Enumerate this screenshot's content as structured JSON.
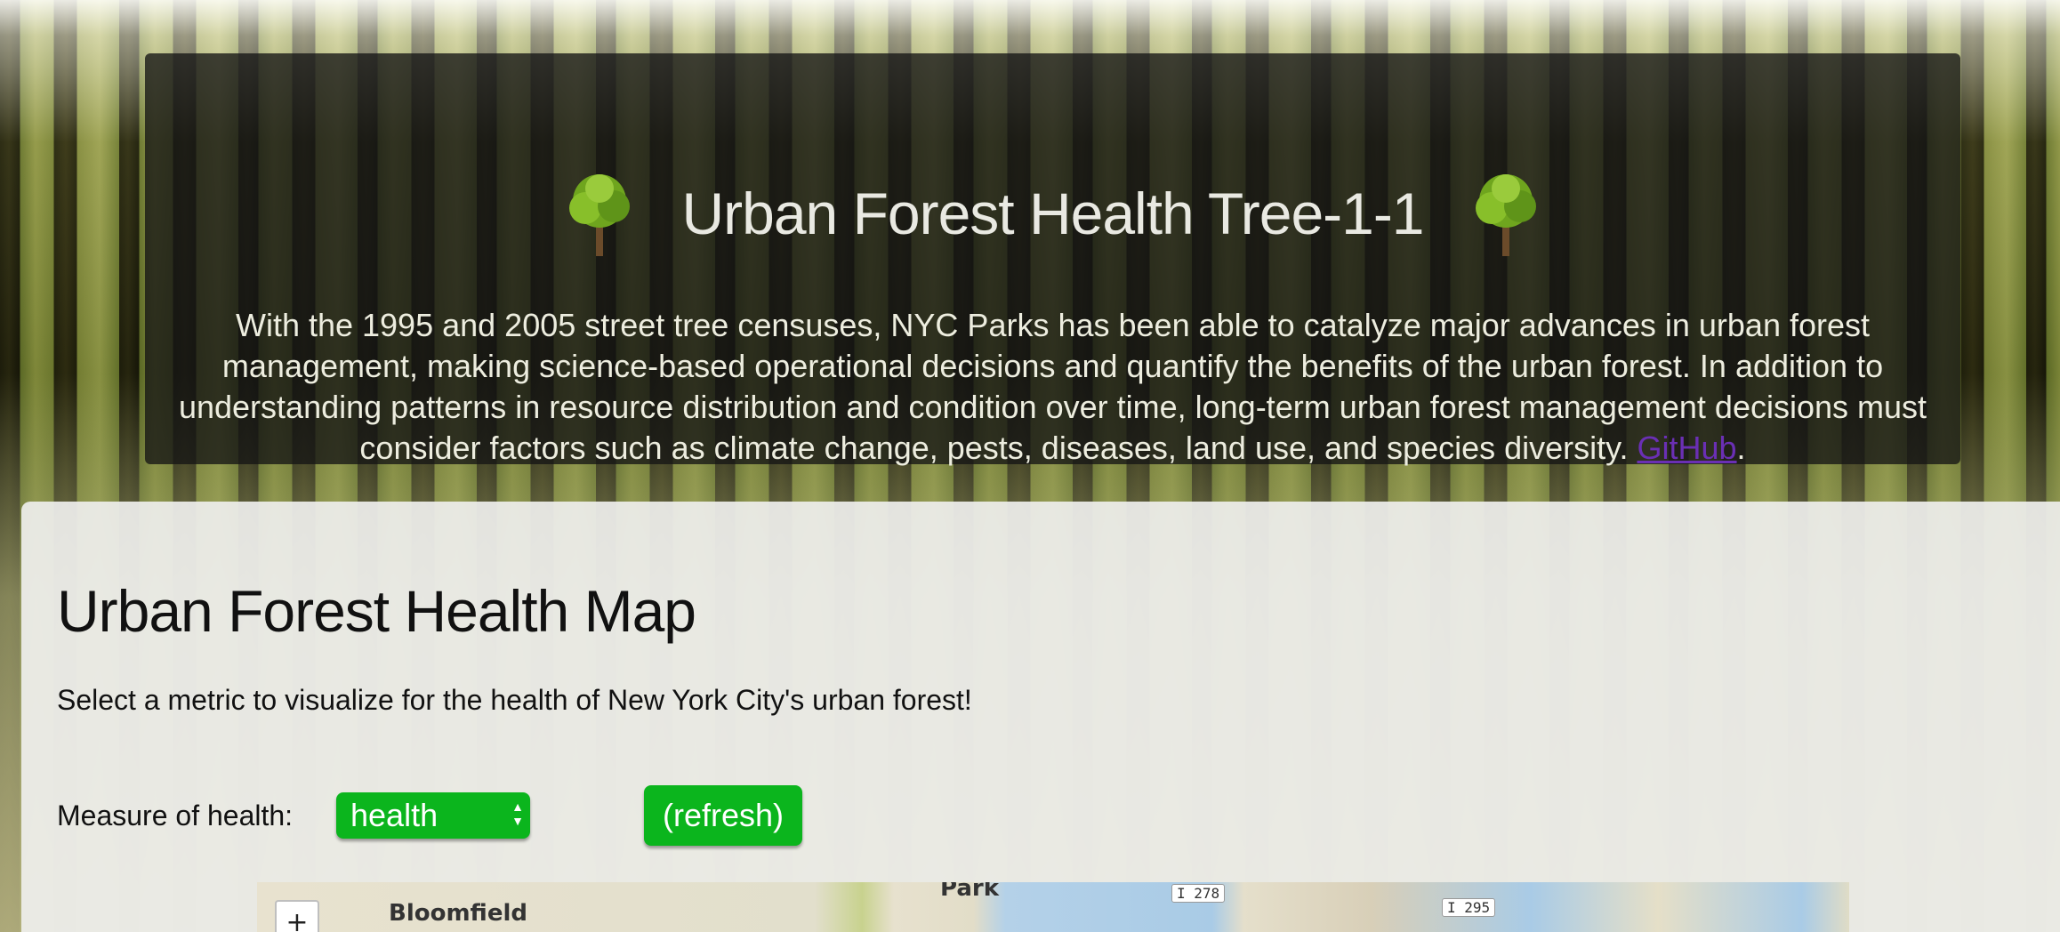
{
  "header": {
    "title": "Urban Forest Health Tree-1-1",
    "intro": "With the 1995 and 2005 street tree censuses, NYC Parks has been able to catalyze major advances in urban forest management, making science-based operational decisions and quantify the benefits of the urban forest. In addition to understanding patterns in resource distribution and condition over time, long-term urban forest management decisions must consider factors such as climate change, pests, diseases, land use, and species diversity.",
    "link_label": "GitHub",
    "link_suffix": ".",
    "icons": [
      "tree-icon",
      "tree-icon"
    ]
  },
  "main": {
    "title": "Urban Forest Health Map",
    "subtitle": "Select a metric to visualize for the health of New York City's urban forest!",
    "measure_label": "Measure of health:",
    "select_value": "health",
    "refresh_label": "(refresh)"
  },
  "map": {
    "zoom_in": "+",
    "labels": [
      "Bloomfield",
      "Park"
    ],
    "shields": [
      "I 278",
      "I 295"
    ]
  },
  "colors": {
    "accent_green": "#0bb51d",
    "link_purple": "#6a2fb4",
    "header_bg": "rgba(20,20,20,0.78)"
  }
}
